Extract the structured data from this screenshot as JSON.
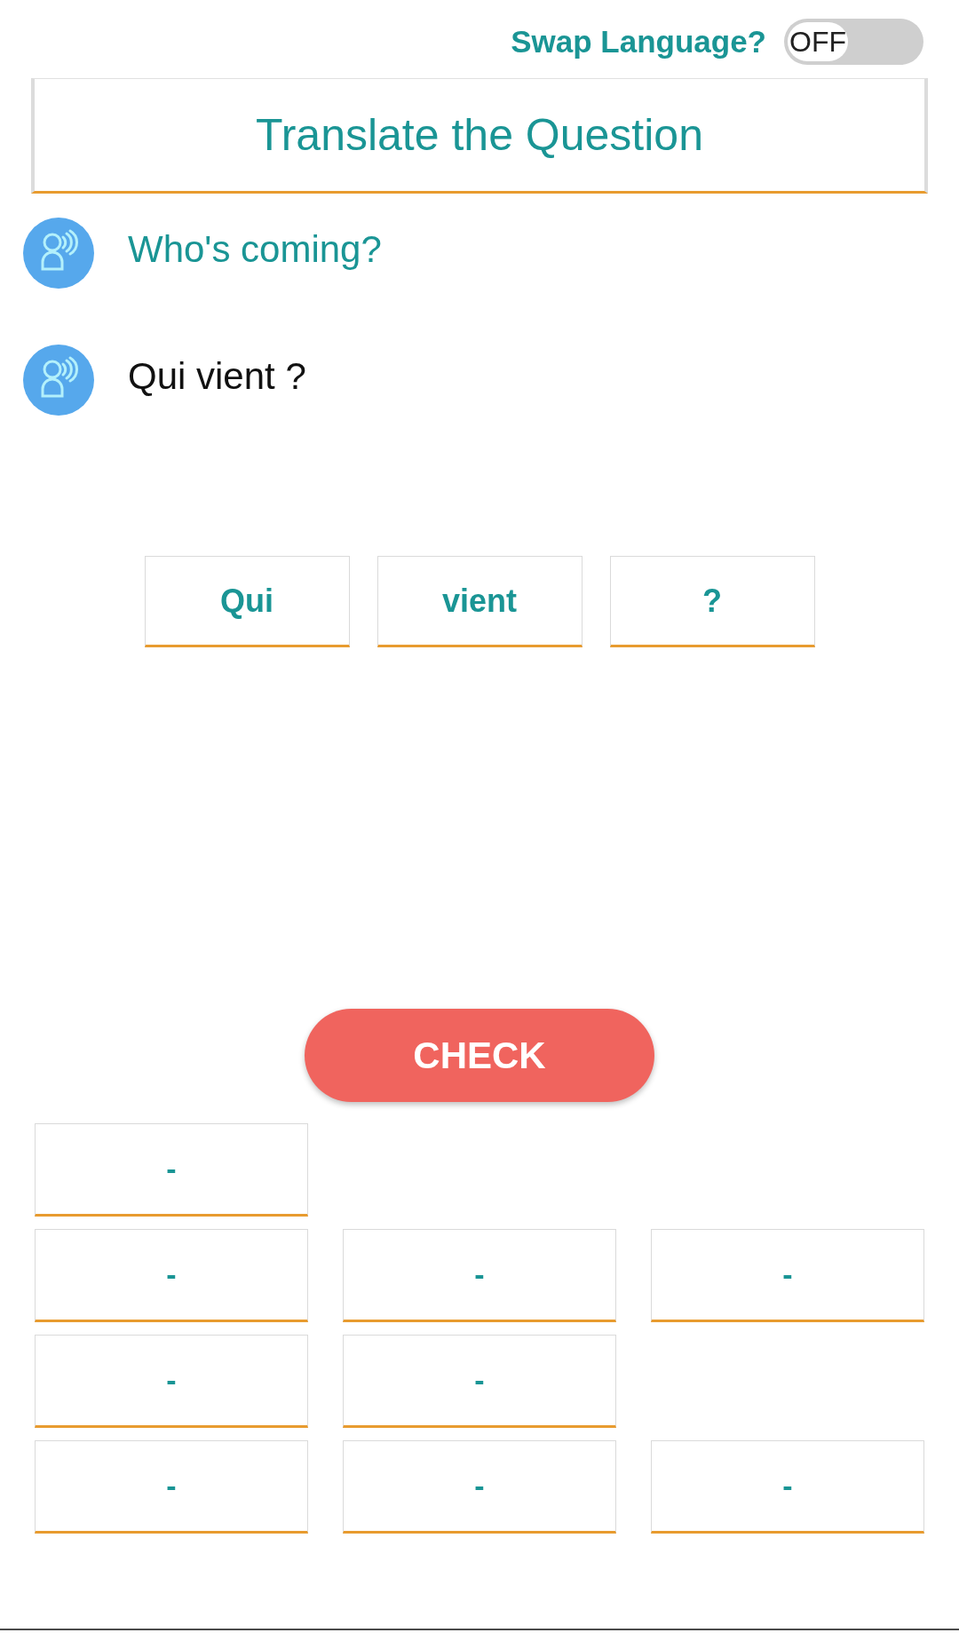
{
  "swap_language": {
    "label": "Swap Language?",
    "switch": {
      "text": "OFF",
      "on": false
    }
  },
  "header": {
    "title": "Translate the Question"
  },
  "prompts": [
    {
      "kind": "question",
      "text": "Who's coming?"
    },
    {
      "kind": "answer",
      "text": "Qui vient ?"
    }
  ],
  "word_tiles": [
    {
      "label": "Qui"
    },
    {
      "label": "vient"
    },
    {
      "label": "?"
    }
  ],
  "check_button": {
    "label": "CHECK"
  },
  "answer_slots": [
    [
      {
        "label": "-"
      }
    ],
    [
      {
        "label": "-"
      },
      {
        "label": "-"
      },
      {
        "label": "-"
      }
    ],
    [
      {
        "label": "-"
      },
      {
        "label": "-"
      }
    ],
    [
      {
        "label": "-"
      },
      {
        "label": "-"
      },
      {
        "label": "-"
      }
    ]
  ]
}
